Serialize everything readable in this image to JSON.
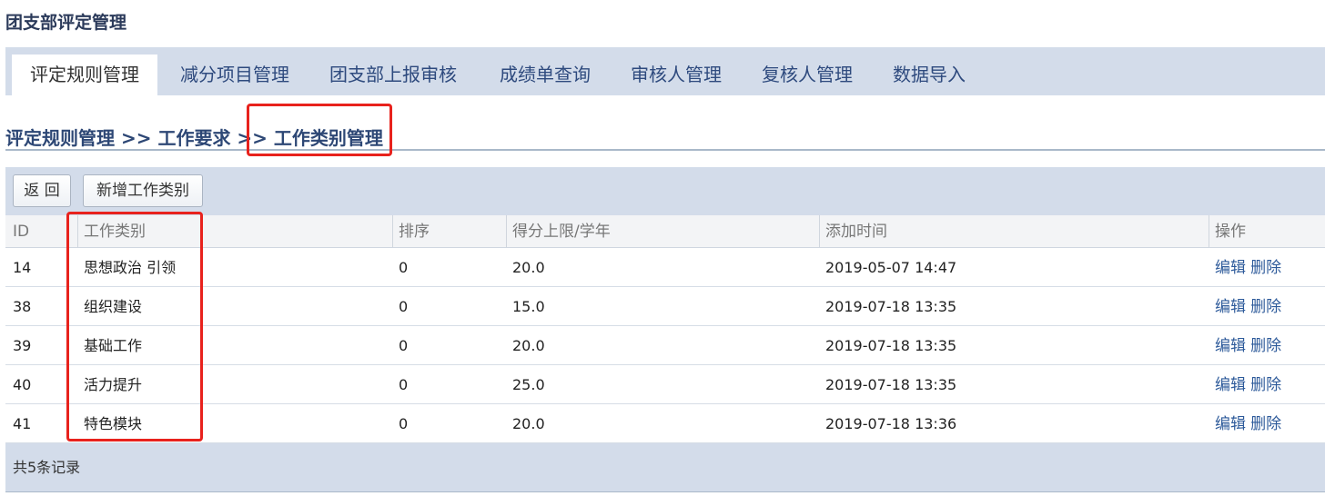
{
  "app": {
    "title": "团支部评定管理"
  },
  "tabs": [
    {
      "label": "评定规则管理",
      "active": true
    },
    {
      "label": "减分项目管理"
    },
    {
      "label": "团支部上报审核"
    },
    {
      "label": "成绩单查询"
    },
    {
      "label": "审核人管理"
    },
    {
      "label": "复核人管理"
    },
    {
      "label": "数据导入"
    }
  ],
  "breadcrumb": {
    "items": [
      "评定规则管理",
      "工作要求",
      "工作类别管理"
    ],
    "separator": ">>"
  },
  "toolbar": {
    "back_label": "返 回",
    "add_label": "新增工作类别"
  },
  "table": {
    "columns": [
      "ID",
      "工作类别",
      "排序",
      "得分上限/学年",
      "添加时间",
      "操作"
    ],
    "rows": [
      {
        "id": "14",
        "category": "思想政治 引领",
        "order": "0",
        "limit": "20.0",
        "time": "2019-05-07 14:47",
        "edit": "编辑",
        "delete": "删除"
      },
      {
        "id": "38",
        "category": "组织建设",
        "order": "0",
        "limit": "15.0",
        "time": "2019-07-18 13:35",
        "edit": "编辑",
        "delete": "删除"
      },
      {
        "id": "39",
        "category": "基础工作",
        "order": "0",
        "limit": "20.0",
        "time": "2019-07-18 13:35",
        "edit": "编辑",
        "delete": "删除"
      },
      {
        "id": "40",
        "category": "活力提升",
        "order": "0",
        "limit": "25.0",
        "time": "2019-07-18 13:35",
        "edit": "编辑",
        "delete": "删除"
      },
      {
        "id": "41",
        "category": "特色模块",
        "order": "0",
        "limit": "20.0",
        "time": "2019-07-18 13:36",
        "edit": "编辑",
        "delete": "删除"
      }
    ]
  },
  "footer": {
    "record_count": "共5条记录"
  },
  "colors": {
    "highlight_box": "#e8221d",
    "bar_bg": "#d3dcea",
    "link": "#2d5a9a"
  }
}
